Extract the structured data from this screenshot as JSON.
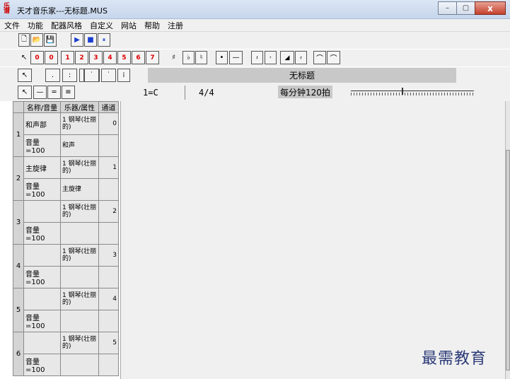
{
  "window": {
    "title": "天才音乐家---无标题.MUS",
    "app_icon_top": "乐",
    "app_icon_bottom": "谱",
    "minimize": "–",
    "maximize": "▢",
    "close": "x"
  },
  "menu": [
    "文件",
    "功能",
    "配器风格",
    "自定义",
    "网站",
    "帮助",
    "注册"
  ],
  "toolbar1": {
    "new": "🗋",
    "open": "📂",
    "save": "💾",
    "play": "▶",
    "stop": "■",
    "pause": "⏸"
  },
  "toolbar2": {
    "notes": [
      "0",
      "1",
      "2",
      "3",
      "4",
      "5",
      "6",
      "7"
    ],
    "sharp": "♯",
    "flat": "♭",
    "natural": "♮",
    "dot": "•",
    "dash": "—",
    "tie": "⌒",
    "slur": "⌒"
  },
  "toolbar3": {
    "pointer": "↖",
    "buttons": [
      ".",
      ":",
      "⁝",
      "˙",
      "⁚",
      "⁞"
    ]
  },
  "score_title": "无标题",
  "toolbar4": {
    "pointer": "↖"
  },
  "key": "1=C",
  "meter": "4/4",
  "tempo": "每分钟120拍",
  "table": {
    "headers": {
      "name": "名称/音量",
      "instrument": "乐器/属性",
      "channel": "通道"
    },
    "tracks": [
      {
        "num": "1",
        "name": "和声部",
        "instrument": "1 钢琴(壮丽的)",
        "channel": "0",
        "volume": "音量=100",
        "property": "和声"
      },
      {
        "num": "2",
        "name": "主旋律",
        "instrument": "1 钢琴(壮丽的)",
        "channel": "1",
        "volume": "音量=100",
        "property": "主旋律"
      },
      {
        "num": "3",
        "name": "",
        "instrument": "1 钢琴(壮丽的)",
        "channel": "2",
        "volume": "音量=100",
        "property": ""
      },
      {
        "num": "4",
        "name": "",
        "instrument": "1 钢琴(壮丽的)",
        "channel": "3",
        "volume": "音量=100",
        "property": ""
      },
      {
        "num": "5",
        "name": "",
        "instrument": "1 钢琴(壮丽的)",
        "channel": "4",
        "volume": "音量=100",
        "property": ""
      },
      {
        "num": "6",
        "name": "",
        "instrument": "1 钢琴(壮丽的)",
        "channel": "5",
        "volume": "音量=100",
        "property": ""
      }
    ]
  },
  "watermark": "最需教育"
}
